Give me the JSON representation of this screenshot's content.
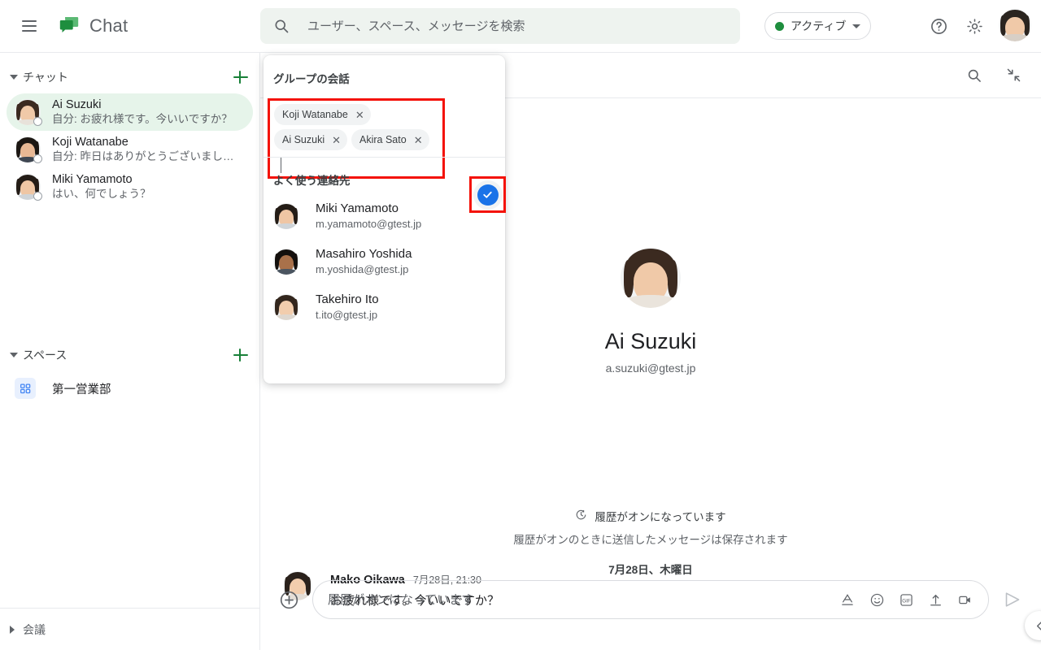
{
  "app": {
    "title": "Chat",
    "logo_icon": "chat-bubble-icon",
    "menu_icon": "hamburger-menu-icon"
  },
  "search": {
    "placeholder": "ユーザー、スペース、メッセージを検索",
    "icon": "search-icon",
    "value": ""
  },
  "header": {
    "status_label": "アクティブ",
    "status_color": "#1e8e3e",
    "help_icon": "help-icon",
    "settings_icon": "gear-icon",
    "apps_icon": "apps-grid-icon",
    "account_icon": "account-avatar"
  },
  "sidebar": {
    "chat_section": {
      "label": "チャット",
      "add_label": "+",
      "expanded": true,
      "items": [
        {
          "name": "Ai Suzuki",
          "snippet": "自分: お疲れ様です。今いいですか？",
          "selected": true
        },
        {
          "name": "Koji Watanabe",
          "snippet": "自分: 昨日はありがとうございました…",
          "selected": false
        },
        {
          "name": "Miki Yamamoto",
          "snippet": "はい、何でしょう？",
          "selected": false
        }
      ]
    },
    "space_section": {
      "label": "スペース",
      "add_label": "+",
      "expanded": true,
      "items": [
        {
          "name": "第一営業部",
          "icon": "space-grid-icon"
        }
      ]
    },
    "meet_section": {
      "label": "会議",
      "expanded": false
    }
  },
  "main": {
    "toolbar": {
      "search_icon": "search-icon",
      "collapse_icon": "collapse-arrows-icon"
    },
    "hero": {
      "name": "Ai Suzuki",
      "email": "a.suzuki@gtest.jp"
    },
    "history": {
      "icon": "history-clock-icon",
      "title": "履歴がオンになっています",
      "subtitle": "履歴がオンのときに送信したメッセージは保存されます",
      "date": "7月28日、木曜日"
    },
    "messages": [
      {
        "author": "Mako Oikawa",
        "time": "7月28日, 21:30",
        "text": "お疲れ様です。今いいですか？"
      }
    ],
    "composer": {
      "add_icon": "plus-circle-icon",
      "placeholder": "履歴がオンになっています",
      "value": "",
      "tools": [
        {
          "icon": "format-text-icon",
          "label": "A"
        },
        {
          "icon": "emoji-icon",
          "label": ""
        },
        {
          "icon": "gif-icon",
          "label": "GIF"
        },
        {
          "icon": "upload-icon",
          "label": ""
        },
        {
          "icon": "video-icon",
          "label": ""
        }
      ],
      "send_icon": "send-icon"
    },
    "expand_icon": "chevron-left-icon"
  },
  "dialog": {
    "title": "グループの会話",
    "chips": [
      {
        "label": "Koji Watanabe",
        "remove_icon": "close-icon"
      },
      {
        "label": "Ai Suzuki",
        "remove_icon": "close-icon"
      },
      {
        "label": "Akira Sato",
        "remove_icon": "close-icon"
      }
    ],
    "input_value": "",
    "confirm_icon": "check-circle-icon",
    "confirm_color": "#1a73e8",
    "highlight_color": "#f41208",
    "contacts_label": "よく使う連絡先",
    "contacts": [
      {
        "name": "Miki Yamamoto",
        "email": "m.yamamoto@gtest.jp"
      },
      {
        "name": "Masahiro Yoshida",
        "email": "m.yoshida@gtest.jp"
      },
      {
        "name": "Takehiro Ito",
        "email": "t.ito@gtest.jp"
      }
    ]
  }
}
